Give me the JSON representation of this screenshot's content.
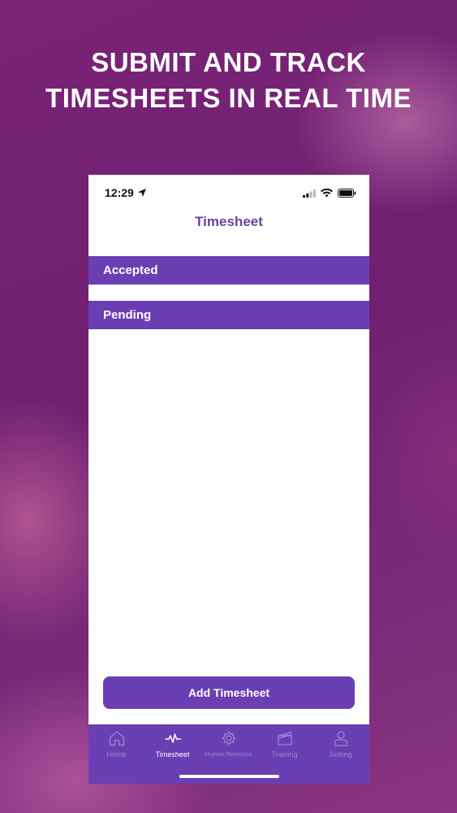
{
  "promo": {
    "headline_line1": "SUBMIT AND TRACK",
    "headline_line2": "TIMESHEETS IN REAL TIME"
  },
  "status_bar": {
    "time": "12:29"
  },
  "header": {
    "title": "Timesheet"
  },
  "sections": [
    {
      "label": "Accepted"
    },
    {
      "label": "Pending"
    }
  ],
  "actions": {
    "add_label": "Add Timesheet"
  },
  "tabbar": {
    "items": [
      {
        "label": "Home",
        "icon": "home-icon",
        "active": false
      },
      {
        "label": "Timesheet",
        "icon": "pulse-icon",
        "active": true
      },
      {
        "label": "Human Resource",
        "icon": "gear-icon",
        "active": false
      },
      {
        "label": "Training",
        "icon": "clapperboard-icon",
        "active": false
      },
      {
        "label": "Setting",
        "icon": "user-icon",
        "active": false
      }
    ]
  },
  "colors": {
    "accent": "#6a3fb3",
    "title": "#6a3ea6",
    "background": "#7a2377"
  }
}
